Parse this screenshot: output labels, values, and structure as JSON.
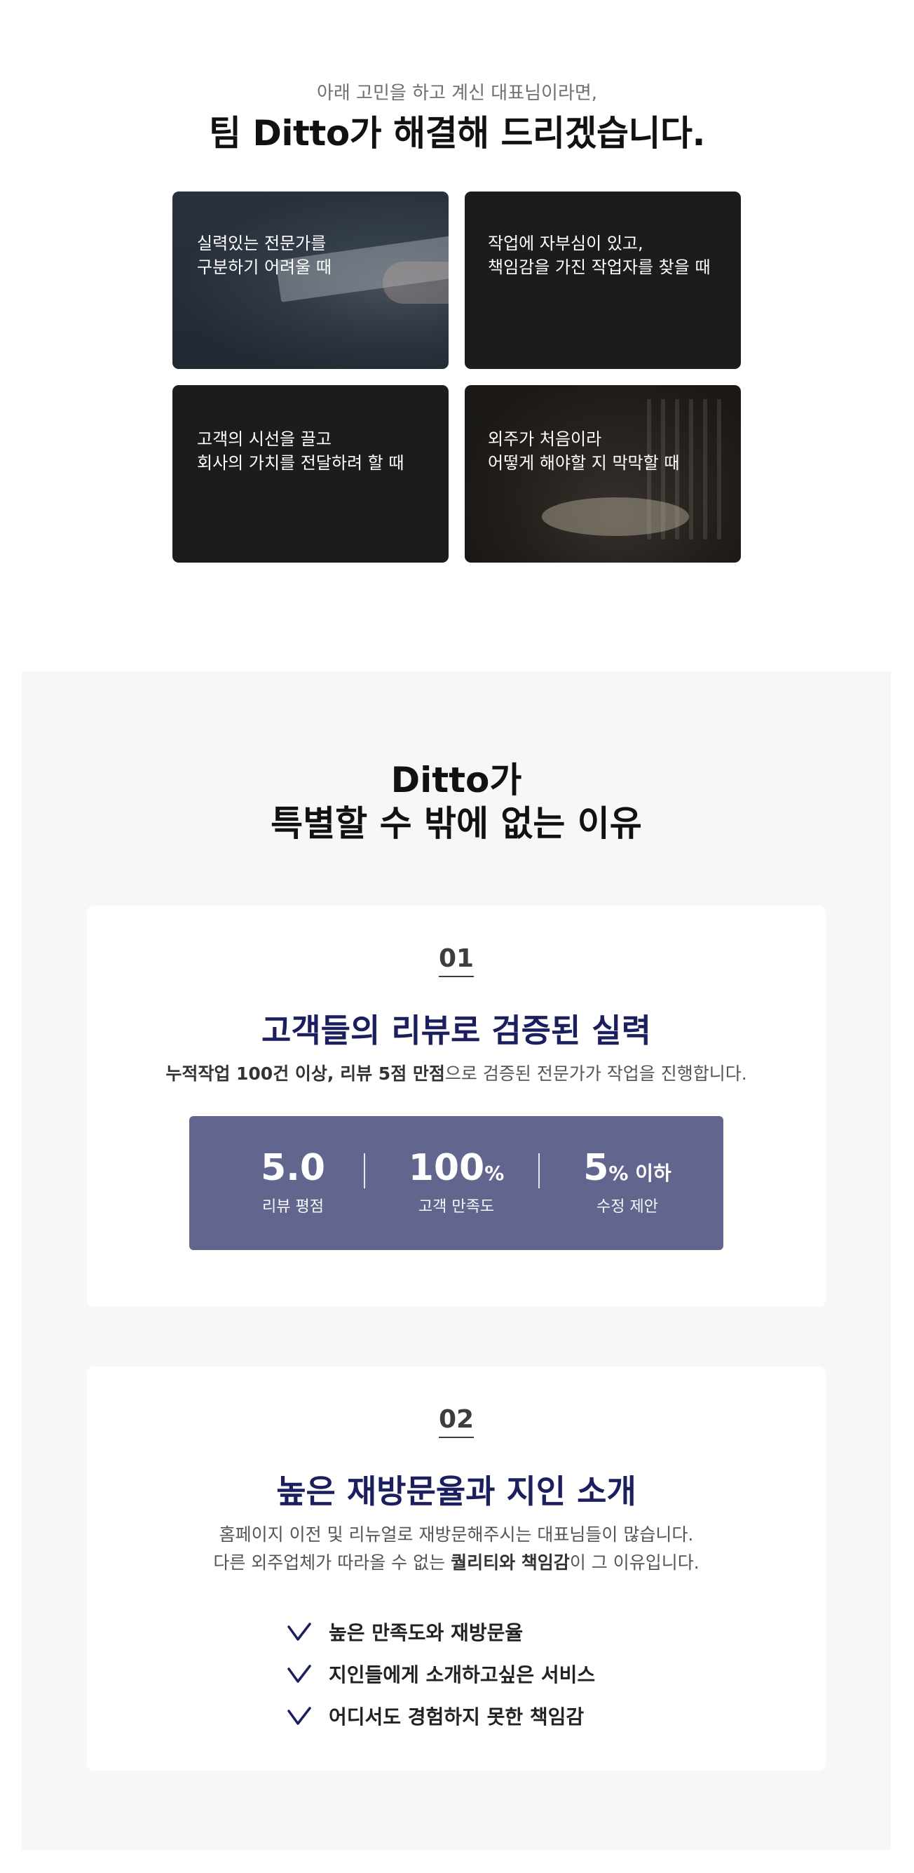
{
  "hero": {
    "subtitle": "아래 고민을 하고 계신 대표님이라면,",
    "title": "팀 Ditto가 해결해 드리겠습니다.",
    "cards": [
      {
        "line1": "실력있는 전문가를",
        "line2": "구분하기 어려울 때"
      },
      {
        "line1": "작업에 자부심이 있고,",
        "line2": "책임감을 가진 작업자를 찾을 때"
      },
      {
        "line1": "고객의 시선을 끌고",
        "line2": "회사의 가치를 전달하려 할 때"
      },
      {
        "line1": "외주가 처음이라",
        "line2": "어떻게 해야할 지 막막할 때"
      }
    ]
  },
  "why": {
    "title_line1": "Ditto가",
    "title_line2": "특별할 수 밖에 없는 이유",
    "feature1": {
      "number": "01",
      "title": "고객들의 리뷰로 검증된 실력",
      "desc_bold": "누적작업 100건 이상, 리뷰 5점 만점",
      "desc_rest": "으로 검증된 전문가가 작업을 진행합니다.",
      "stats": [
        {
          "value": "5.0",
          "unit": "",
          "label": "리뷰 평점"
        },
        {
          "value": "100",
          "unit": "%",
          "label": "고객 만족도"
        },
        {
          "value": "5",
          "unit": "% 이하",
          "label": "수정 제안"
        }
      ]
    },
    "feature2": {
      "number": "02",
      "title": "높은 재방문율과 지인 소개",
      "desc_line1": "홈페이지 이전 및 리뉴얼로 재방문해주시는 대표님들이 많습니다.",
      "desc_line2_pre": "다른 외주업체가 따라올 수 없는 ",
      "desc_line2_bold": "퀄리티와 책임감",
      "desc_line2_post": "이 그 이유입니다.",
      "checklist": [
        "높은 만족도와 재방문율",
        "지인들에게 소개하고싶은 서비스",
        "어디서도 경험하지 못한 책임감"
      ]
    }
  },
  "colors": {
    "accent_navy": "#1b1f5e",
    "stats_bg": "#62668f",
    "section_bg": "#f7f7f9",
    "card_bg": "#1c1c1c"
  },
  "icons": {
    "check": "check-icon"
  }
}
